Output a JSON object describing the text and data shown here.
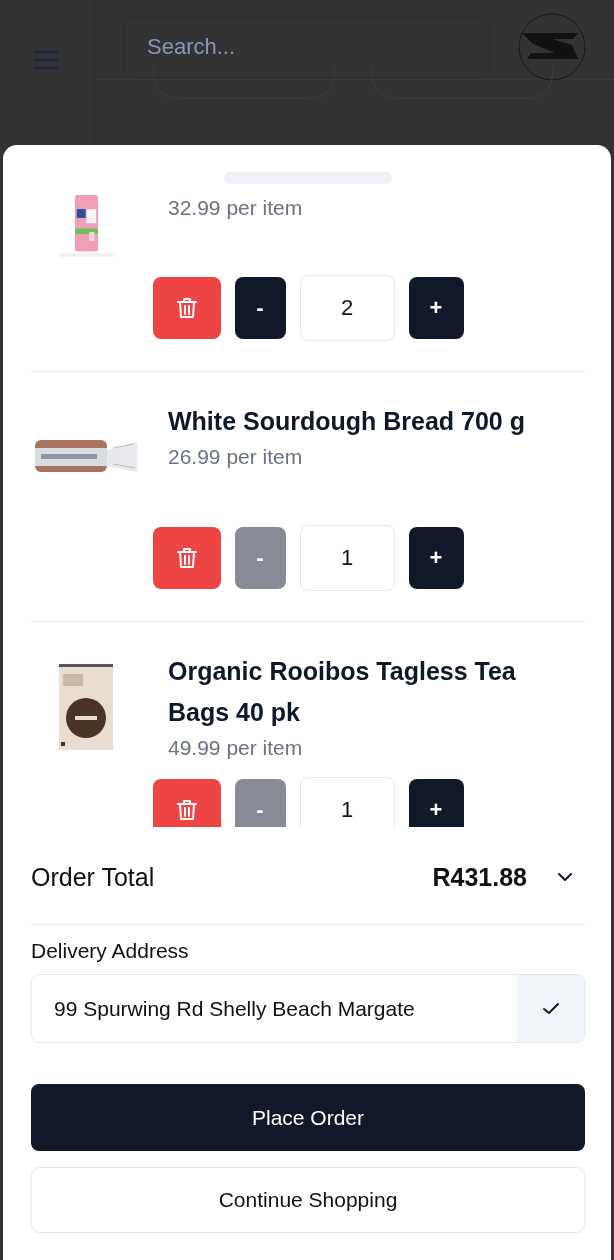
{
  "header": {
    "search": {
      "placeholder": "Search..."
    }
  },
  "cart": {
    "items": [
      {
        "price": "32.99 per item",
        "quantity": "2",
        "decrease": {
          "label": "-",
          "disabled": false
        },
        "increase": {
          "label": "+"
        }
      },
      {
        "name": "White Sourdough Bread 700 g",
        "price": "26.99 per item",
        "quantity": "1",
        "decrease": {
          "label": "-",
          "disabled": true
        },
        "increase": {
          "label": "+"
        }
      },
      {
        "name": "Organic Rooibos Tagless Tea Bags 40 pk",
        "price": "49.99 per item",
        "quantity": "1",
        "decrease": {
          "label": "-",
          "disabled": true
        },
        "increase": {
          "label": "+"
        }
      }
    ]
  },
  "order_total": {
    "label": "Order Total",
    "amount": "R431.88"
  },
  "delivery": {
    "label": "Delivery Address",
    "address": "99 Spurwing Rd Shelly Beach Margate"
  },
  "buttons": {
    "primary": "Place Order",
    "secondary": "Continue Shopping"
  }
}
